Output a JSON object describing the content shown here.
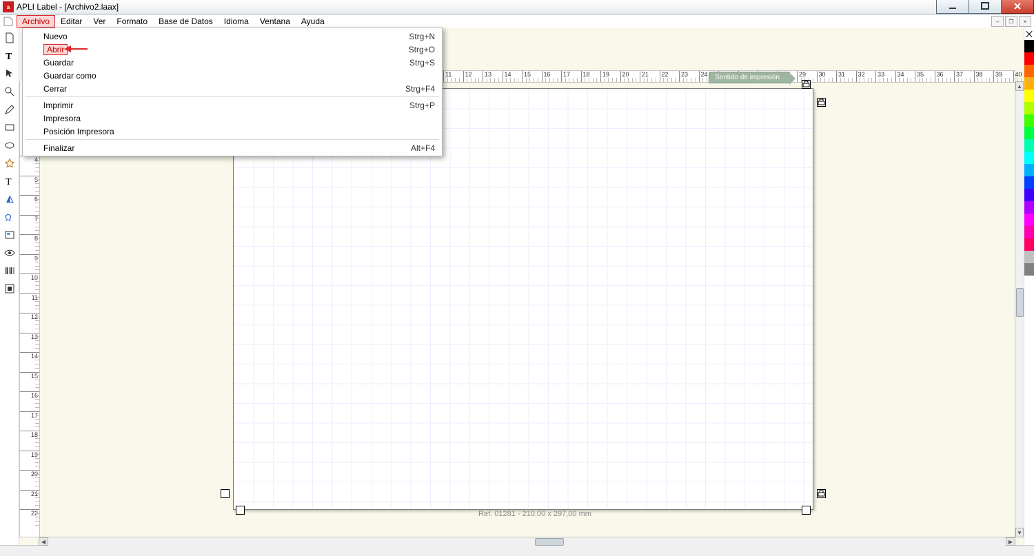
{
  "window": {
    "title": "APLI Label - [Archivo2.laax]"
  },
  "menubar": {
    "items": [
      "Archivo",
      "Editar",
      "Ver",
      "Formato",
      "Base de Datos",
      "Idioma",
      "Ventana",
      "Ayuda"
    ],
    "active_index": 0
  },
  "dropdown": {
    "highlight_index": 1,
    "sections": [
      [
        {
          "label": "Nuevo",
          "shortcut": "Strg+N"
        },
        {
          "label": "Abrir",
          "shortcut": "Strg+O"
        },
        {
          "label": "Guardar",
          "shortcut": "Strg+S"
        },
        {
          "label": "Guardar como",
          "shortcut": ""
        },
        {
          "label": "Cerrar",
          "shortcut": "Strg+F4"
        }
      ],
      [
        {
          "label": "Imprimir",
          "shortcut": "Strg+P"
        },
        {
          "label": "Impresora",
          "shortcut": ""
        },
        {
          "label": "Posición Impresora",
          "shortcut": ""
        }
      ],
      [
        {
          "label": "Finalizar",
          "shortcut": "Alt+F4"
        }
      ]
    ]
  },
  "canvas": {
    "hint": "Sentido de impresión",
    "page_info": "Ref. 01281 - 210,00 x 297,00 mm"
  },
  "ruler": {
    "h_start": 11,
    "h_end": 40,
    "v_start": 4,
    "v_end": 22
  },
  "color_swatches": [
    "#000000",
    "#ff0000",
    "#ff6600",
    "#ffb000",
    "#ffff00",
    "#b0ff00",
    "#40ff00",
    "#00ff40",
    "#00ffb0",
    "#00ffff",
    "#00b0ff",
    "#0040ff",
    "#4000ff",
    "#b000ff",
    "#ff00ff",
    "#ff00b0",
    "#ff0060",
    "#c0c0c0",
    "#808080"
  ],
  "tool_icons": [
    "new-doc",
    "text",
    "pointer",
    "zoom",
    "pencil",
    "rectangle",
    "ellipse",
    "shape-star",
    "text-frame",
    "flip",
    "omega",
    "align-box",
    "eye",
    "barcode",
    "select-box"
  ]
}
